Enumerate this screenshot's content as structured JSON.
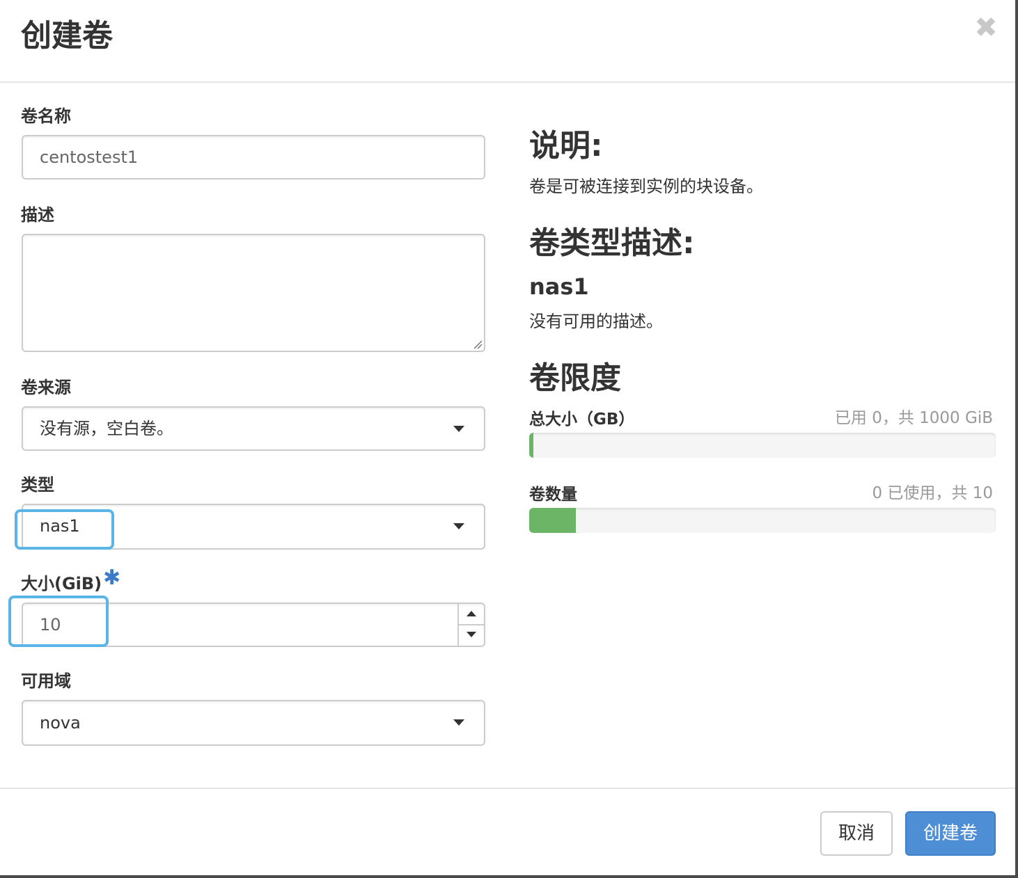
{
  "dialog": {
    "title": "创建卷",
    "close_glyph": "✖"
  },
  "form": {
    "name": {
      "label": "卷名称",
      "value": "centostest1"
    },
    "description": {
      "label": "描述",
      "value": ""
    },
    "source": {
      "label": "卷来源",
      "selected": "没有源，空白卷。"
    },
    "type": {
      "label": "类型",
      "selected": "nas1"
    },
    "size": {
      "label": "大小(GiB)",
      "required_mark": "✱",
      "value": "10"
    },
    "availability_zone": {
      "label": "可用域",
      "selected": "nova"
    }
  },
  "info": {
    "description_heading": "说明:",
    "description_text": "卷是可被连接到实例的块设备。",
    "type_heading": "卷类型描述:",
    "type_name": "nas1",
    "type_text": "没有可用的描述。",
    "limits_heading": "卷限度",
    "quotas": [
      {
        "label": "总大小（GB）",
        "text": "已用 0，共 1000 GiB",
        "used": 0,
        "total": 1000
      },
      {
        "label": "卷数量",
        "text": "0 已使用，共 10",
        "used": 0,
        "total": 10,
        "fill_fraction": 0.1
      }
    ]
  },
  "footer": {
    "cancel_label": "取消",
    "submit_label": "创建卷"
  },
  "colors": {
    "primary": "#4e8ed4",
    "highlight": "#5ab5e6",
    "progress": "#6db566",
    "required": "#3a7ac9"
  }
}
